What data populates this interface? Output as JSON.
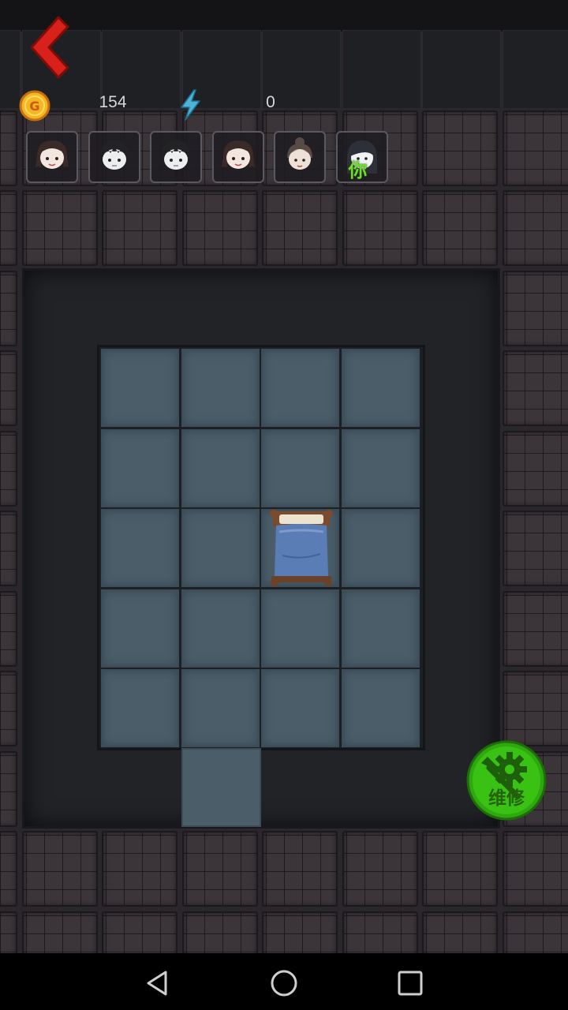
{
  "hud": {
    "gold_value": "154",
    "energy_value": "0",
    "icons": [
      "back-arrow-icon",
      "gold-coin-icon",
      "lightning-icon"
    ],
    "coin_letter": "G",
    "accent_red": "#d8211a",
    "accent_gold": "#f1b823",
    "accent_energy": "#4fb2d4"
  },
  "players": [
    {
      "name": "player-girl-1"
    },
    {
      "name": "player-boy-1"
    },
    {
      "name": "player-boy-2"
    },
    {
      "name": "player-girl-2"
    },
    {
      "name": "player-girl-3"
    },
    {
      "name": "player-you",
      "label": "你"
    }
  ],
  "room": {
    "bed": "bed-icon"
  },
  "repair": {
    "label": "维修",
    "color": "#2ea80f"
  },
  "navbar": {
    "buttons": [
      "back-nav-icon",
      "home-nav-icon",
      "recents-nav-icon"
    ]
  }
}
